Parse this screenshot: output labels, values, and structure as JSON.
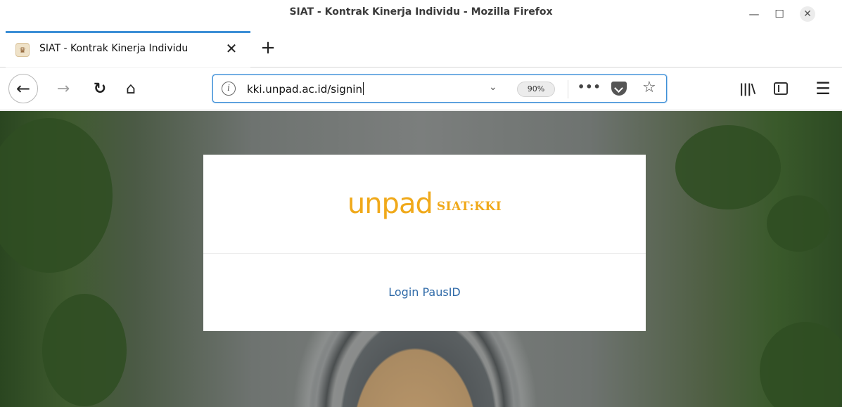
{
  "window": {
    "title": "SIAT - Kontrak Kinerja Individu - Mozilla Firefox",
    "minimize_icon": "minimize-icon",
    "maximize_icon": "maximize-icon",
    "close_icon": "close-icon"
  },
  "tabs": [
    {
      "title": "SIAT - Kontrak Kinerja Individu",
      "favicon": "unpad-favicon",
      "active": true
    }
  ],
  "toolbar": {
    "url": "kki.unpad.ac.id/signin",
    "zoom": "90%",
    "icons": [
      "back-icon",
      "forward-icon",
      "reload-icon",
      "home-icon",
      "info-icon",
      "dropdown-icon",
      "more-icon",
      "pocket-icon",
      "bookmark-star-icon",
      "library-icon",
      "sidebar-icon",
      "menu-icon"
    ]
  },
  "page": {
    "logo": {
      "brand": "unpad",
      "product": "SIAT:KKI"
    },
    "login_link": "Login PausID"
  },
  "colors": {
    "accent": "#3d8fd6",
    "logo": "#f0a91a",
    "link": "#2f6aa8"
  }
}
